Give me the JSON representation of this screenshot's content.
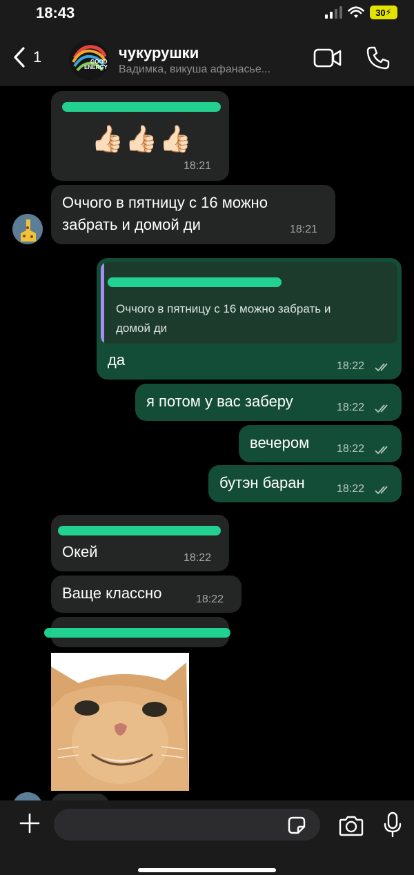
{
  "status": {
    "time": "18:43",
    "battery": "30"
  },
  "header": {
    "back_count": "1",
    "title": "чукурушки",
    "subtitle": "Вадимка, викуша афанасье...",
    "avatar_text_1": "GOOD",
    "avatar_text_2": "ENERGY"
  },
  "messages": [
    {
      "id": "m1",
      "dir": "in",
      "emoji": "👍🏻👍🏻👍🏻",
      "time": "18:21"
    },
    {
      "id": "m2",
      "dir": "in",
      "lines": [
        "Оччого в пятницу с 16 можно",
        "забрать и домой ди"
      ],
      "time": "18:21"
    },
    {
      "id": "m3",
      "dir": "out",
      "quote_lines": [
        "Оччого в пятницу с 16 можно забрать и",
        "домой ди"
      ],
      "text": "да",
      "time": "18:22"
    },
    {
      "id": "m4",
      "dir": "out",
      "text": "я потом у вас заберу",
      "time": "18:22"
    },
    {
      "id": "m5",
      "dir": "out",
      "text": "вечером",
      "time": "18:22"
    },
    {
      "id": "m6",
      "dir": "out",
      "text": "бутэн баран",
      "time": "18:22"
    },
    {
      "id": "m7",
      "dir": "in",
      "text": "Окей",
      "time": "18:22"
    },
    {
      "id": "m8",
      "dir": "in",
      "text": "Ваще классно",
      "time": "18:22"
    }
  ],
  "colors": {
    "incoming": "#242626",
    "outgoing": "#144d37",
    "quote_accent": "#a58ef0",
    "redaction": "#22e39c"
  },
  "icons": [
    "chevron-left-icon",
    "video-icon",
    "phone-icon",
    "plus-icon",
    "sticker-icon",
    "camera-icon",
    "mic-icon",
    "double-check-icon",
    "wifi-icon",
    "signal-icon"
  ]
}
